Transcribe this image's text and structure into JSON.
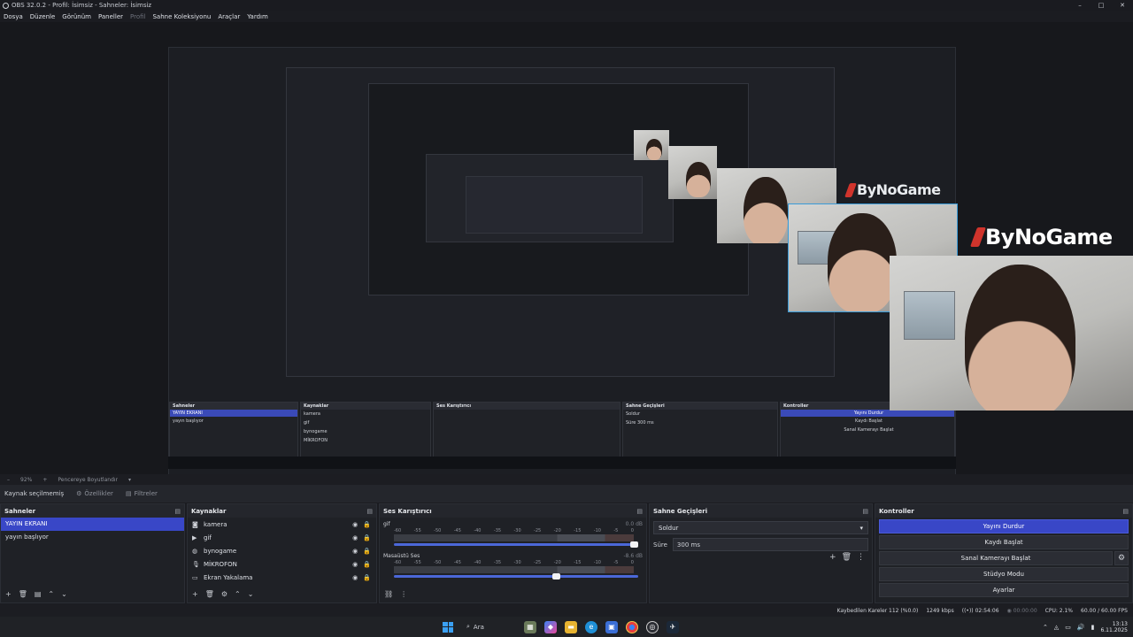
{
  "window": {
    "title": "OBS 32.0.2 - Profil: İsimsiz - Sahneler: İsimsiz",
    "controls": {
      "minimize": "–",
      "maximize": "□",
      "close": "✕"
    }
  },
  "menu": {
    "items": [
      "Dosya",
      "Düzenle",
      "Görünüm",
      "Paneller",
      "Profil",
      "Sahne Koleksiyonu",
      "Araçlar",
      "Yardım"
    ]
  },
  "preview": {
    "zoom": "92%",
    "resize_label": "Pencereye Boyutlandır",
    "overlay_logo": "ByNoGame"
  },
  "source_toolbar": {
    "label": "Kaynak seçilmemiş",
    "properties": "Özellikler",
    "filters": "Filtreler"
  },
  "scenes": {
    "title": "Sahneler",
    "items": [
      {
        "label": "YAYIN EKRANI",
        "selected": true
      },
      {
        "label": "yayın başlıyor",
        "selected": false
      }
    ]
  },
  "sources": {
    "title": "Kaynaklar",
    "items": [
      {
        "label": "kamera",
        "icon": "camera-icon"
      },
      {
        "label": "gif",
        "icon": "play-icon"
      },
      {
        "label": "bynogame",
        "icon": "browser-icon"
      },
      {
        "label": "MİKROFON",
        "icon": "microphone-icon"
      },
      {
        "label": "Ekran Yakalama",
        "icon": "monitor-icon"
      }
    ]
  },
  "mixer": {
    "title": "Ses Karıştırıcı",
    "scale": [
      "-60",
      "-55",
      "-50",
      "-45",
      "-40",
      "-35",
      "-30",
      "-25",
      "-20",
      "-15",
      "-10",
      "-5",
      "0"
    ],
    "channels": [
      {
        "name": "gif",
        "db": "0.0 dB",
        "volume": 1.0
      },
      {
        "name": "Masaüstü Ses",
        "db": "-8.6 dB",
        "volume": 0.68
      }
    ]
  },
  "transitions": {
    "title": "Sahne Geçişleri",
    "selected": "Soldur",
    "duration_label": "Süre",
    "duration_value": "300 ms"
  },
  "controls": {
    "title": "Kontroller",
    "stop_stream": "Yayını Durdur",
    "start_record": "Kaydı Başlat",
    "virtual_cam": "Sanal Kamerayı Başlat",
    "studio_mode": "Stüdyo Modu",
    "settings": "Ayarlar"
  },
  "status": {
    "dropped": "Kaybedilen Kareler 112 (%0.0)",
    "bitrate": "1249 kbps",
    "stream_time": "02:54:06",
    "record_time": "00:00:00",
    "cpu": "CPU: 2.1%",
    "fps": "60.00 / 60.00 FPS"
  },
  "taskbar": {
    "search": "Ara",
    "time": "13:13",
    "date": "6.11.2025"
  }
}
